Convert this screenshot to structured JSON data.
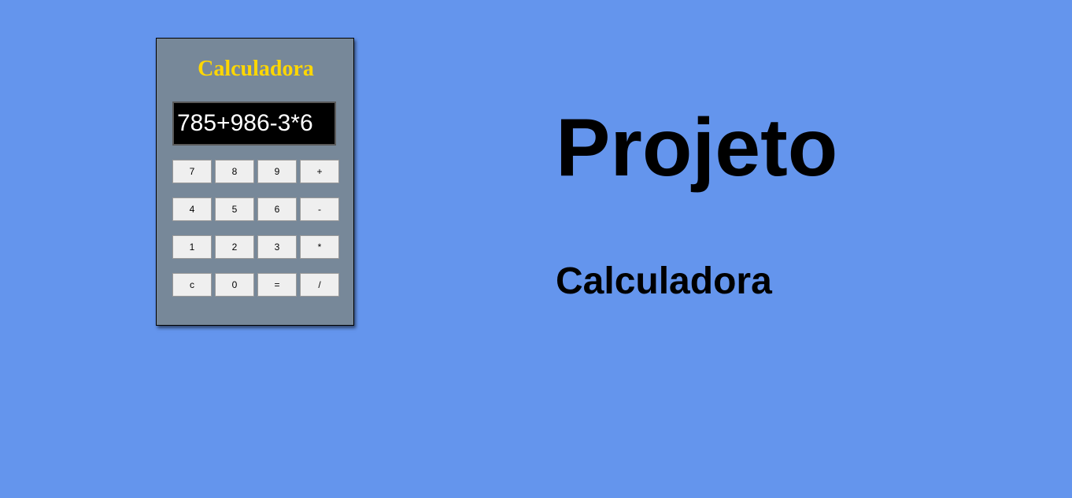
{
  "colors": {
    "background": "#6495ED",
    "calculator_body": "#778899",
    "calculator_title": "#FFD700",
    "display_bg": "#000000",
    "display_text": "#FFFFFF",
    "key_bg": "#EFEFEF"
  },
  "calculator": {
    "title": "Calculadora",
    "display_value": "785+986-3*6",
    "rows": [
      [
        "7",
        "8",
        "9",
        "+"
      ],
      [
        "4",
        "5",
        "6",
        "-"
      ],
      [
        "1",
        "2",
        "3",
        "*"
      ],
      [
        "c",
        "0",
        "=",
        "/"
      ]
    ]
  },
  "main": {
    "title": "Projeto",
    "subtitle": "Calculadora"
  }
}
